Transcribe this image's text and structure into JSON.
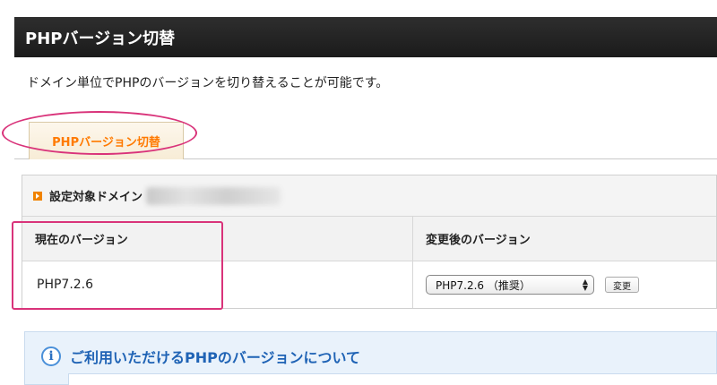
{
  "header": {
    "title": "PHPバージョン切替"
  },
  "description": "ドメイン単位でPHPのバージョンを切り替えることが可能です。",
  "tab": {
    "label": "PHPバージョン切替"
  },
  "panel": {
    "title": "設定対象ドメイン",
    "bullet_icon": "orange-arrow-bullet-icon"
  },
  "table": {
    "current_header": "現在のバージョン",
    "new_header": "変更後のバージョン",
    "current_value": "PHP7.2.6",
    "select_value": "PHP7.2.6 （推奨）",
    "change_button": "変更"
  },
  "info": {
    "icon": "info-icon",
    "title": "ご利用いただけるPHPのバージョンについて"
  },
  "colors": {
    "accent_orange": "#ff7a00",
    "annotation_pink": "#d9337a",
    "info_blue": "#1f63b5"
  }
}
